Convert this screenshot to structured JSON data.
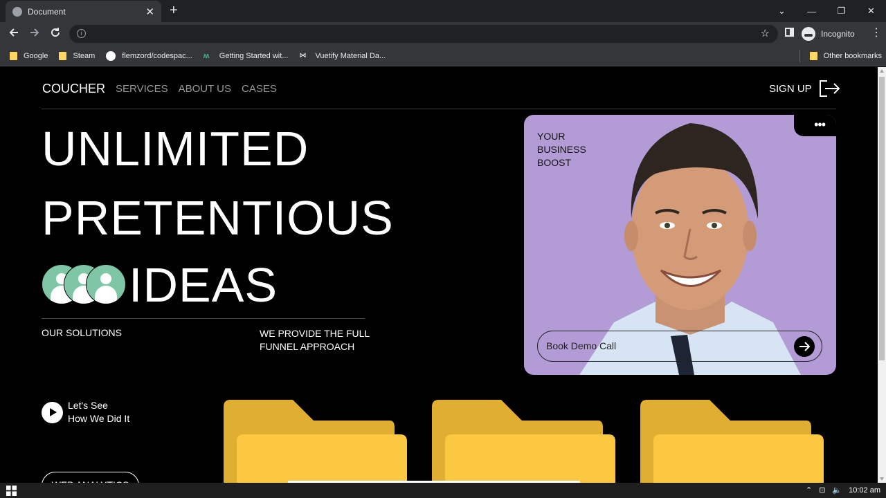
{
  "browser": {
    "tab_title": "Document",
    "tab_close": "✕",
    "new_tab": "+",
    "window_buttons": [
      "⌄",
      "—",
      "❐",
      "✕"
    ],
    "incognito_label": "Incognito",
    "bookmarks": [
      {
        "label": "Google",
        "icon": "folder-icon"
      },
      {
        "label": "Steam",
        "icon": "folder-icon"
      },
      {
        "label": "flemzord/codespac...",
        "icon": "github-icon"
      },
      {
        "label": "Getting Started wit...",
        "icon": "m-logo-icon"
      },
      {
        "label": "Vuetify Material Da...",
        "icon": "bowtie-icon"
      }
    ],
    "other_bookmarks": "Other bookmarks"
  },
  "nav": {
    "logo": "COUCHER",
    "links": [
      "SERVICES",
      "ABOUT US",
      "CASES"
    ],
    "signup": "SIGN UP"
  },
  "hero": {
    "line1": "UNLIMITED",
    "line2": "PRETENTIOUS",
    "line3": "IDEAS",
    "our_solutions": "OUR SOLUTIONS",
    "funnel": "WE PROVIDE THE FULL FUNNEL APPROACH",
    "lets_see_1": "Let's See",
    "lets_see_2": "How We Did It",
    "analytics_button": "WEB ANALYTICS"
  },
  "card": {
    "menu": "•••",
    "boost_1": "YOUR",
    "boost_2": "BUSINESS",
    "boost_3": "BOOST",
    "book_demo": "Book Demo Call"
  },
  "taskbar": {
    "time": "10:02 am"
  },
  "colors": {
    "accent_green": "#7fc6a6",
    "card_purple": "#b39bd5",
    "folder_back": "#e0ae30",
    "folder_front": "#fcc841"
  }
}
